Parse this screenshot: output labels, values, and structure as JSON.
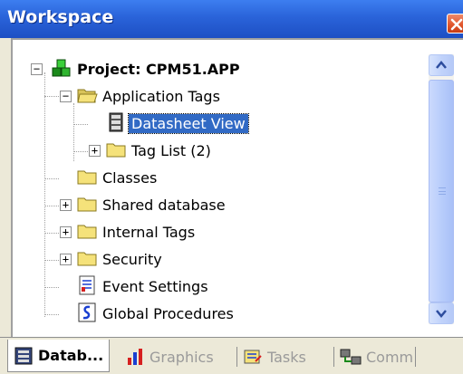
{
  "window": {
    "title": "Workspace",
    "close_icon": "close-icon"
  },
  "tree": {
    "root": {
      "label": "Project: CPM51.APP",
      "expander": "−",
      "icon": "project-icon"
    },
    "items": [
      {
        "label": "Application Tags",
        "expander": "−",
        "icon": "folder-open-icon"
      },
      {
        "label": "Datasheet View",
        "icon": "datasheet-icon",
        "selected": true
      },
      {
        "label": "Tag List (2)",
        "expander": "+",
        "icon": "folder-icon"
      },
      {
        "label": "Classes",
        "icon": "folder-icon"
      },
      {
        "label": "Shared database",
        "expander": "+",
        "icon": "folder-icon"
      },
      {
        "label": "Internal Tags",
        "expander": "+",
        "icon": "folder-icon"
      },
      {
        "label": "Security",
        "expander": "+",
        "icon": "folder-icon"
      },
      {
        "label": "Event Settings",
        "icon": "event-settings-icon"
      },
      {
        "label": "Global Procedures",
        "icon": "global-procedures-icon"
      }
    ]
  },
  "tabs": [
    {
      "label": "Datab...",
      "icon": "database-icon",
      "active": true
    },
    {
      "label": "Graphics",
      "icon": "graphics-icon",
      "active": false
    },
    {
      "label": "Tasks",
      "icon": "tasks-icon",
      "active": false
    },
    {
      "label": "Comm",
      "icon": "comm-icon",
      "active": false
    }
  ],
  "colors": {
    "title_bar": "#2a63d9",
    "selection": "#316ac5",
    "folder": "#f5e27a"
  }
}
